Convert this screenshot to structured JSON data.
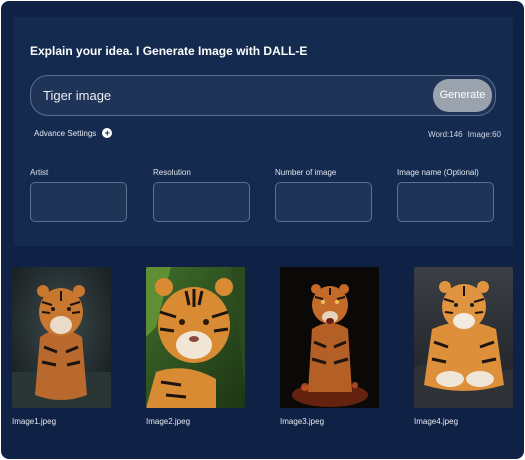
{
  "header": {
    "title": "Explain your idea. I Generate Image with DALL-E"
  },
  "prompt": {
    "value": "Tiger image",
    "generate_label": "Generate"
  },
  "settings": {
    "advance_label": "Advance Settings",
    "word_label": "Word:",
    "word_count": "146",
    "image_label": "Image:",
    "image_count": "60"
  },
  "fields": [
    {
      "label": "Artist"
    },
    {
      "label": "Resolution"
    },
    {
      "label": "Number of image"
    },
    {
      "label": "Image name (Optional)"
    }
  ],
  "gallery": [
    {
      "name": "Image1.jpeg"
    },
    {
      "name": "Image2.jpeg"
    },
    {
      "name": "Image3.jpeg"
    },
    {
      "name": "Image4.jpeg"
    }
  ],
  "colors": {
    "background": "#0f2144",
    "panel": "#142a4f",
    "input": "#1f3457",
    "input_border": "#5b6f8f",
    "button": "#9aa3ad",
    "text": "#ffffff"
  },
  "icons": {
    "advance": "plus-circle-icon"
  }
}
